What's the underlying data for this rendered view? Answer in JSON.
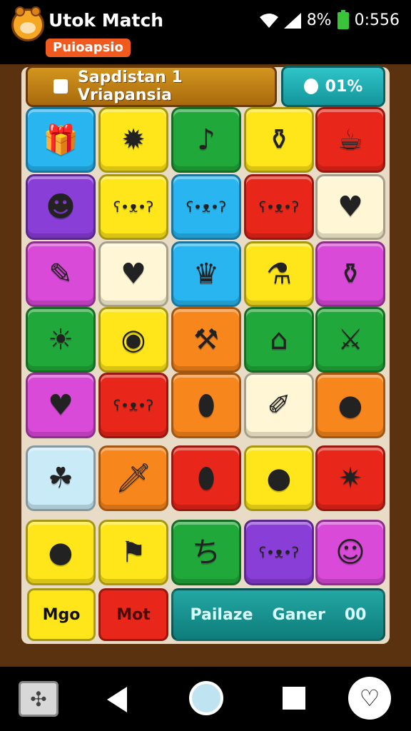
{
  "app": {
    "title": "Utok Match",
    "subtitle": "Puioapsio"
  },
  "status": {
    "battery_text": "8%",
    "time": "0:556"
  },
  "header": {
    "left_label": "Sapdistan 1 Vriapansia",
    "right_label": "01%"
  },
  "tiles": [
    {
      "bg": "#29b6f0",
      "icon": "gift-icon",
      "glyph": "🎁"
    },
    {
      "bg": "#ffe61a",
      "icon": "flame-icon",
      "glyph": "✹"
    },
    {
      "bg": "#21a83a",
      "icon": "note-icon",
      "glyph": "♪"
    },
    {
      "bg": "#ffe61a",
      "icon": "jar-icon",
      "glyph": "⚱"
    },
    {
      "bg": "#e8261a",
      "icon": "cup-icon",
      "glyph": "☕"
    },
    {
      "bg": "#8a3ed8",
      "icon": "frog-icon",
      "glyph": "☻"
    },
    {
      "bg": "#ffe61a",
      "icon": "bear-icon",
      "glyph": "ʕ•ᴥ•ʔ"
    },
    {
      "bg": "#29b6f0",
      "icon": "polar-bear-icon",
      "glyph": "ʕ•ᴥ•ʔ"
    },
    {
      "bg": "#e8261a",
      "icon": "polar-bear-icon",
      "glyph": "ʕ•ᴥ•ʔ"
    },
    {
      "bg": "#fff6d5",
      "icon": "shield-icon",
      "glyph": "♥"
    },
    {
      "bg": "#d94ad8",
      "icon": "wand-icon",
      "glyph": "✎"
    },
    {
      "bg": "#fff6d5",
      "icon": "heart-icon",
      "glyph": "♥"
    },
    {
      "bg": "#29b6f0",
      "icon": "crown-icon",
      "glyph": "♛"
    },
    {
      "bg": "#ffe61a",
      "icon": "pot-icon",
      "glyph": "⚗"
    },
    {
      "bg": "#d94ad8",
      "icon": "bottle-icon",
      "glyph": "⚱"
    },
    {
      "bg": "#21a83a",
      "icon": "sun-icon",
      "glyph": "☀"
    },
    {
      "bg": "#ffe61a",
      "icon": "donut-icon",
      "glyph": "◉"
    },
    {
      "bg": "#f7861d",
      "icon": "hammer-icon",
      "glyph": "⚒"
    },
    {
      "bg": "#21a83a",
      "icon": "tombstone-icon",
      "glyph": "⌂"
    },
    {
      "bg": "#21a83a",
      "icon": "sword-icon",
      "glyph": "⚔"
    },
    {
      "bg": "#d94ad8",
      "icon": "heart-icon",
      "glyph": "♥"
    },
    {
      "bg": "#e8261a",
      "icon": "pig-icon",
      "glyph": "ʕ•ᴥ•ʔ"
    },
    {
      "bg": "#f7861d",
      "icon": "balloon-icon",
      "glyph": "⬮"
    },
    {
      "bg": "#fff6d5",
      "icon": "pen-icon",
      "glyph": "✐"
    },
    {
      "bg": "#f7861d",
      "icon": "balloon-icon",
      "glyph": "●"
    },
    {
      "bg": "#c9eaf7",
      "icon": "cactus-icon",
      "glyph": "☘"
    },
    {
      "bg": "#f7861d",
      "icon": "dagger-icon",
      "glyph": "🗡"
    },
    {
      "bg": "#e8261a",
      "icon": "balloon-icon",
      "glyph": "⬮"
    },
    {
      "bg": "#ffe61a",
      "icon": "lime-icon",
      "glyph": "●"
    },
    {
      "bg": "#e8261a",
      "icon": "star-icon",
      "glyph": "✷"
    },
    {
      "bg": "#ffe61a",
      "icon": "balloon-icon",
      "glyph": "●"
    },
    {
      "bg": "#ffe61a",
      "icon": "flag-icon",
      "glyph": "⚑"
    },
    {
      "bg": "#21a83a",
      "icon": "symbol-icon",
      "glyph": "ち"
    },
    {
      "bg": "#8a3ed8",
      "icon": "ghost-bear-icon",
      "glyph": "ʕ•ᴥ•ʔ"
    },
    {
      "bg": "#d94ad8",
      "icon": "smiley-icon",
      "glyph": "☺"
    }
  ],
  "bottom": {
    "mgo_label": "Mgo",
    "mot_label": "Mot",
    "pause_label": "Pailaze",
    "gamer_label": "Ganer",
    "score": "00"
  },
  "nav": {
    "puzzle_glyph": "✣",
    "heart_glyph": "♡"
  }
}
